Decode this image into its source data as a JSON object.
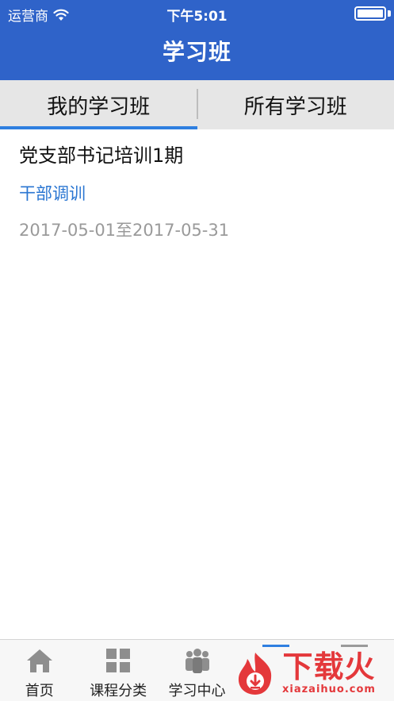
{
  "status_bar": {
    "carrier": "运营商",
    "time": "下午5:01",
    "battery_level": 1.0
  },
  "header": {
    "title": "学习班"
  },
  "tabs": [
    {
      "label": "我的学习班",
      "active": true
    },
    {
      "label": "所有学习班",
      "active": false
    }
  ],
  "classes": [
    {
      "title": "党支部书记培训1期",
      "category": "干部调训",
      "dates": "2017-05-01至2017-05-31"
    }
  ],
  "tabbar": {
    "items": [
      {
        "label": "首页",
        "icon": "home-icon"
      },
      {
        "label": "课程分类",
        "icon": "grid-icon"
      },
      {
        "label": "学习中心",
        "icon": "people-icon"
      }
    ]
  },
  "watermark": {
    "text": "下载火",
    "url": "xiazaihuo.com"
  },
  "colors": {
    "header_bg": "#2f63c9",
    "tab_indicator": "#2f7fe0",
    "category_text": "#2a76d2",
    "watermark": "#e4383b"
  }
}
